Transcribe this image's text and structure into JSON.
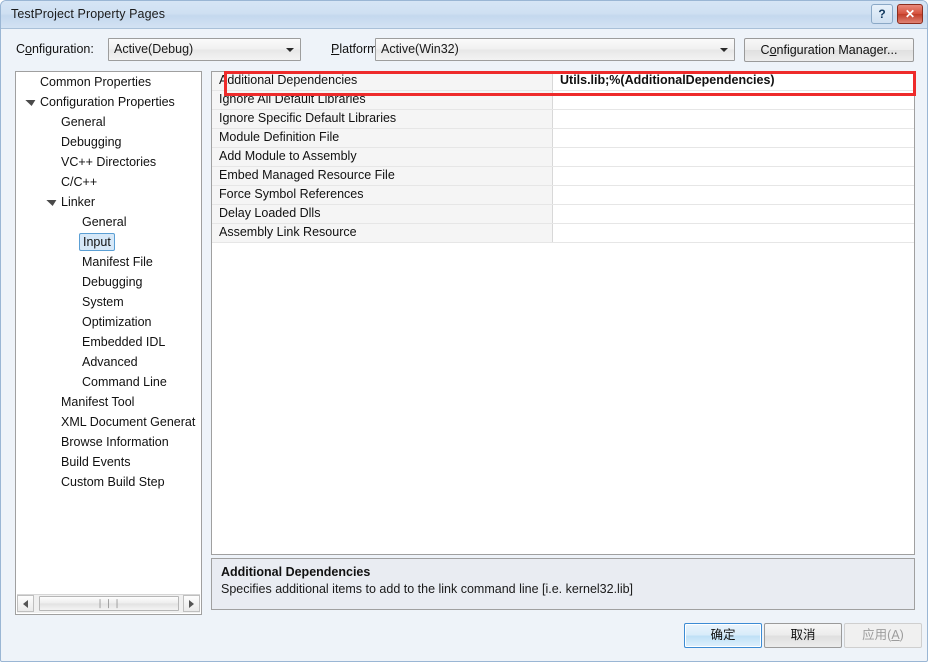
{
  "window": {
    "title": "TestProject Property Pages",
    "help_button": "?",
    "close_button": "✕"
  },
  "config_bar": {
    "configuration_label_pre": "C",
    "configuration_label_accel": "o",
    "configuration_label_post": "nfiguration:",
    "configuration_value": "Active(Debug)",
    "platform_label_pre": "",
    "platform_label_accel": "P",
    "platform_label_post": "latform:",
    "platform_value": "Active(Win32)",
    "config_manager_pre": "C",
    "config_manager_accel": "o",
    "config_manager_post": "nfiguration Manager..."
  },
  "tree": {
    "items": [
      {
        "label": "Common Properties",
        "indent": 0,
        "state": "collapsed",
        "selected": false
      },
      {
        "label": "Configuration Properties",
        "indent": 0,
        "state": "expanded",
        "selected": false
      },
      {
        "label": "General",
        "indent": 1,
        "state": "leaf",
        "selected": false
      },
      {
        "label": "Debugging",
        "indent": 1,
        "state": "leaf",
        "selected": false
      },
      {
        "label": "VC++ Directories",
        "indent": 1,
        "state": "leaf",
        "selected": false
      },
      {
        "label": "C/C++",
        "indent": 1,
        "state": "collapsed",
        "selected": false
      },
      {
        "label": "Linker",
        "indent": 1,
        "state": "expanded",
        "selected": false
      },
      {
        "label": "General",
        "indent": 2,
        "state": "leaf",
        "selected": false
      },
      {
        "label": "Input",
        "indent": 2,
        "state": "leaf",
        "selected": true
      },
      {
        "label": "Manifest File",
        "indent": 2,
        "state": "leaf",
        "selected": false
      },
      {
        "label": "Debugging",
        "indent": 2,
        "state": "leaf",
        "selected": false
      },
      {
        "label": "System",
        "indent": 2,
        "state": "leaf",
        "selected": false
      },
      {
        "label": "Optimization",
        "indent": 2,
        "state": "leaf",
        "selected": false
      },
      {
        "label": "Embedded IDL",
        "indent": 2,
        "state": "leaf",
        "selected": false
      },
      {
        "label": "Advanced",
        "indent": 2,
        "state": "leaf",
        "selected": false
      },
      {
        "label": "Command Line",
        "indent": 2,
        "state": "leaf",
        "selected": false
      },
      {
        "label": "Manifest Tool",
        "indent": 1,
        "state": "collapsed",
        "selected": false
      },
      {
        "label": "XML Document Generat",
        "indent": 1,
        "state": "collapsed",
        "selected": false
      },
      {
        "label": "Browse Information",
        "indent": 1,
        "state": "collapsed",
        "selected": false
      },
      {
        "label": "Build Events",
        "indent": 1,
        "state": "collapsed",
        "selected": false
      },
      {
        "label": "Custom Build Step",
        "indent": 1,
        "state": "collapsed",
        "selected": false
      }
    ],
    "hscroll_grip": "❘❘❘"
  },
  "grid": {
    "rows": [
      {
        "name": "Additional Dependencies",
        "value": "Utils.lib;%(AdditionalDependencies)",
        "selected": true
      },
      {
        "name": "Ignore All Default Libraries",
        "value": "",
        "selected": false
      },
      {
        "name": "Ignore Specific Default Libraries",
        "value": "",
        "selected": false
      },
      {
        "name": "Module Definition File",
        "value": "",
        "selected": false
      },
      {
        "name": "Add Module to Assembly",
        "value": "",
        "selected": false
      },
      {
        "name": "Embed Managed Resource File",
        "value": "",
        "selected": false
      },
      {
        "name": "Force Symbol References",
        "value": "",
        "selected": false
      },
      {
        "name": "Delay Loaded Dlls",
        "value": "",
        "selected": false
      },
      {
        "name": "Assembly Link Resource",
        "value": "",
        "selected": false
      }
    ],
    "highlight_color": "#ee2b2b"
  },
  "description": {
    "title": "Additional Dependencies",
    "text": "Specifies additional items to add to the link command line [i.e. kernel32.lib]"
  },
  "footer": {
    "ok_label": "确定",
    "cancel_label": "取消",
    "apply_pre": "应用(",
    "apply_accel": "A",
    "apply_post": ")"
  }
}
